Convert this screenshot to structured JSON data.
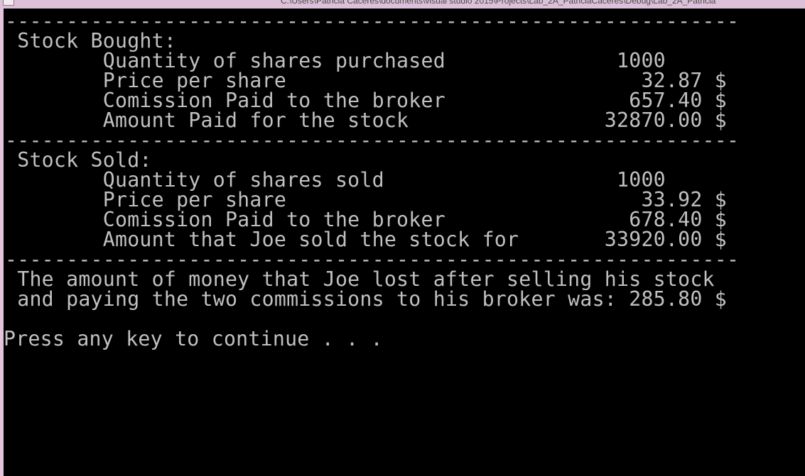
{
  "window": {
    "title": "C:\\Users\\Patricia Caceres\\documents\\visual studio 2015\\Projects\\Lab_2A_PatriciaCaceres\\Debug\\Lab_2A_Patricia"
  },
  "console": {
    "lines": [
      "------------------------------------------------------------",
      " Stock Bought:",
      "        Quantity of shares purchased              1000",
      "        Price per share                             32.87 $",
      "        Comission Paid to the broker               657.40 $",
      "        Amount Paid for the stock                32870.00 $",
      "------------------------------------------------------------",
      " Stock Sold:",
      "        Quantity of shares sold                   1000",
      "        Price per share                             33.92 $",
      "        Comission Paid to the broker               678.40 $",
      "        Amount that Joe sold the stock for       33920.00 $",
      "------------------------------------------------------------",
      " The amount of money that Joe lost after selling his stock",
      " and paying the two commissions to his broker was: 285.80 $",
      "",
      "Press any key to continue . . ."
    ]
  },
  "colors": {
    "background": "#000000",
    "text": "#c0c0c0",
    "frame": "#e8c8e0"
  }
}
